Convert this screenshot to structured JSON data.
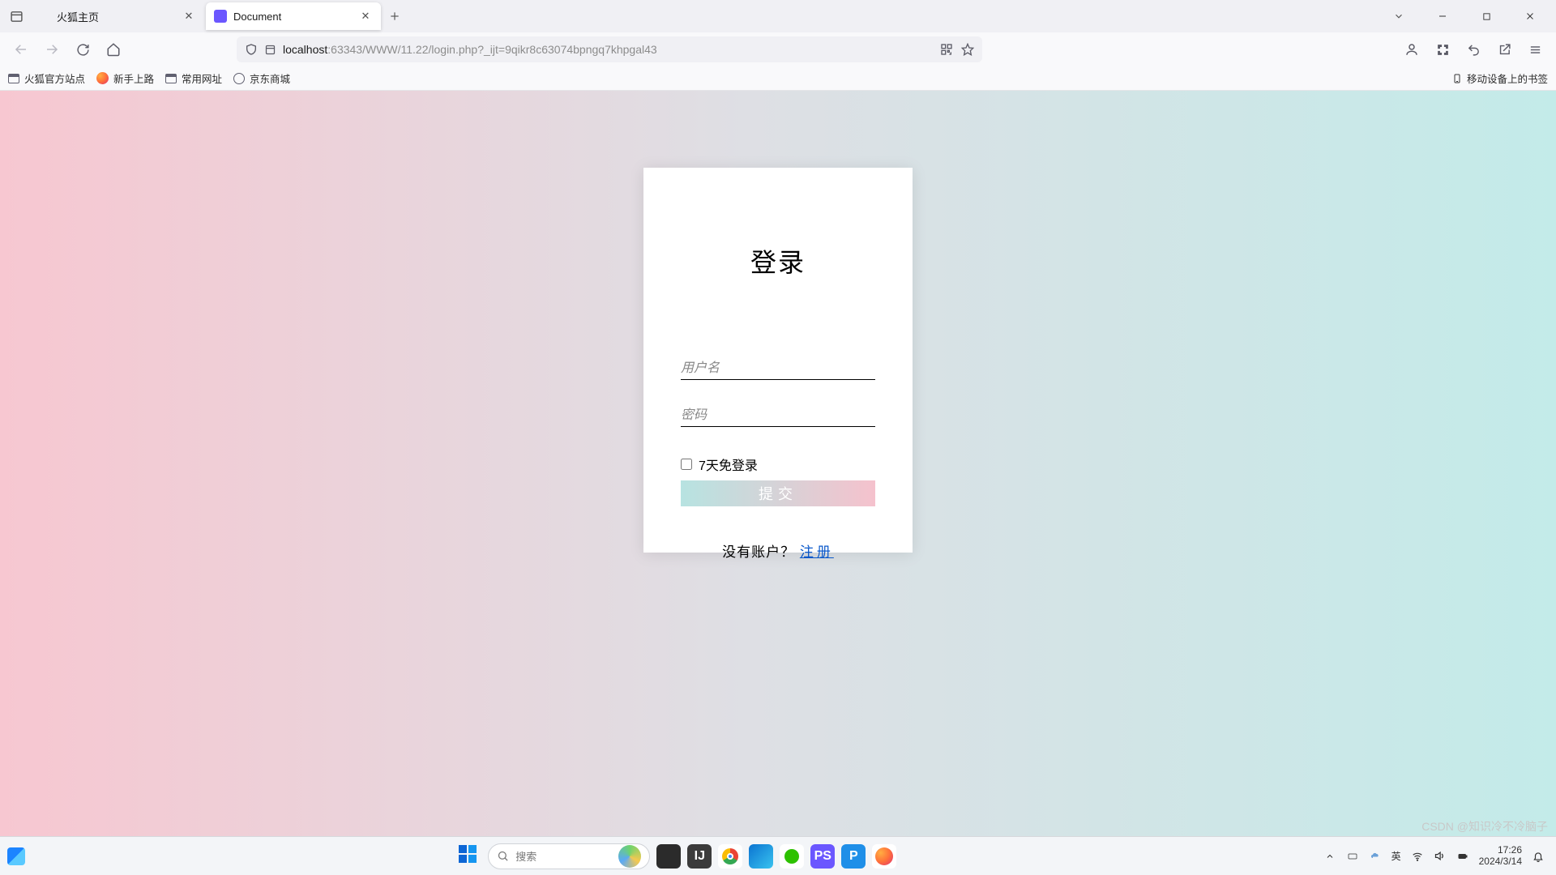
{
  "browser": {
    "tabs": [
      {
        "title": "火狐主页"
      },
      {
        "title": "Document"
      }
    ],
    "url_host": "localhost",
    "url_rest": ":63343/WWW/11.22/login.php?_ijt=9qikr8c63074bpngq7khpgal43",
    "bookmarks": [
      {
        "label": "火狐官方站点",
        "icon": "folder"
      },
      {
        "label": "新手上路",
        "icon": "firefox"
      },
      {
        "label": "常用网址",
        "icon": "folder"
      },
      {
        "label": "京东商城",
        "icon": "globe"
      }
    ],
    "bookmarks_right": "移动设备上的书签"
  },
  "page": {
    "title": "登录",
    "username_placeholder": "用户名",
    "password_placeholder": "密码",
    "remember_label": "7天免登录",
    "submit_label": "提交",
    "footer_text": "没有账户？",
    "footer_link": "注册"
  },
  "taskbar": {
    "search_placeholder": "搜索",
    "ime": "英",
    "time": "17:26",
    "date": "2024/3/14"
  },
  "watermark": "CSDN @知识冷不冷脑子"
}
